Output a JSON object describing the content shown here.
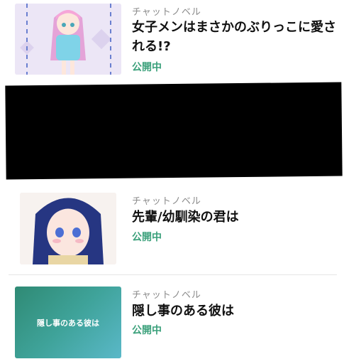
{
  "items": [
    {
      "category": "チャットノベル",
      "title": "女子メンはまさかのぶりっこに愛される!?",
      "status": "公開中"
    },
    {
      "category": "チャットノベル",
      "title": "先輩/幼馴染の君は",
      "status": "公開中"
    },
    {
      "category": "チャットノベル",
      "title": "隠し事のある彼は",
      "status": "公開中",
      "thumb_text": "隠し事のある彼は"
    }
  ],
  "colors": {
    "status_green": "#3aa07a",
    "thumb3_gradient_start": "#2f8a74",
    "thumb3_gradient_end": "#5ab8c8"
  }
}
